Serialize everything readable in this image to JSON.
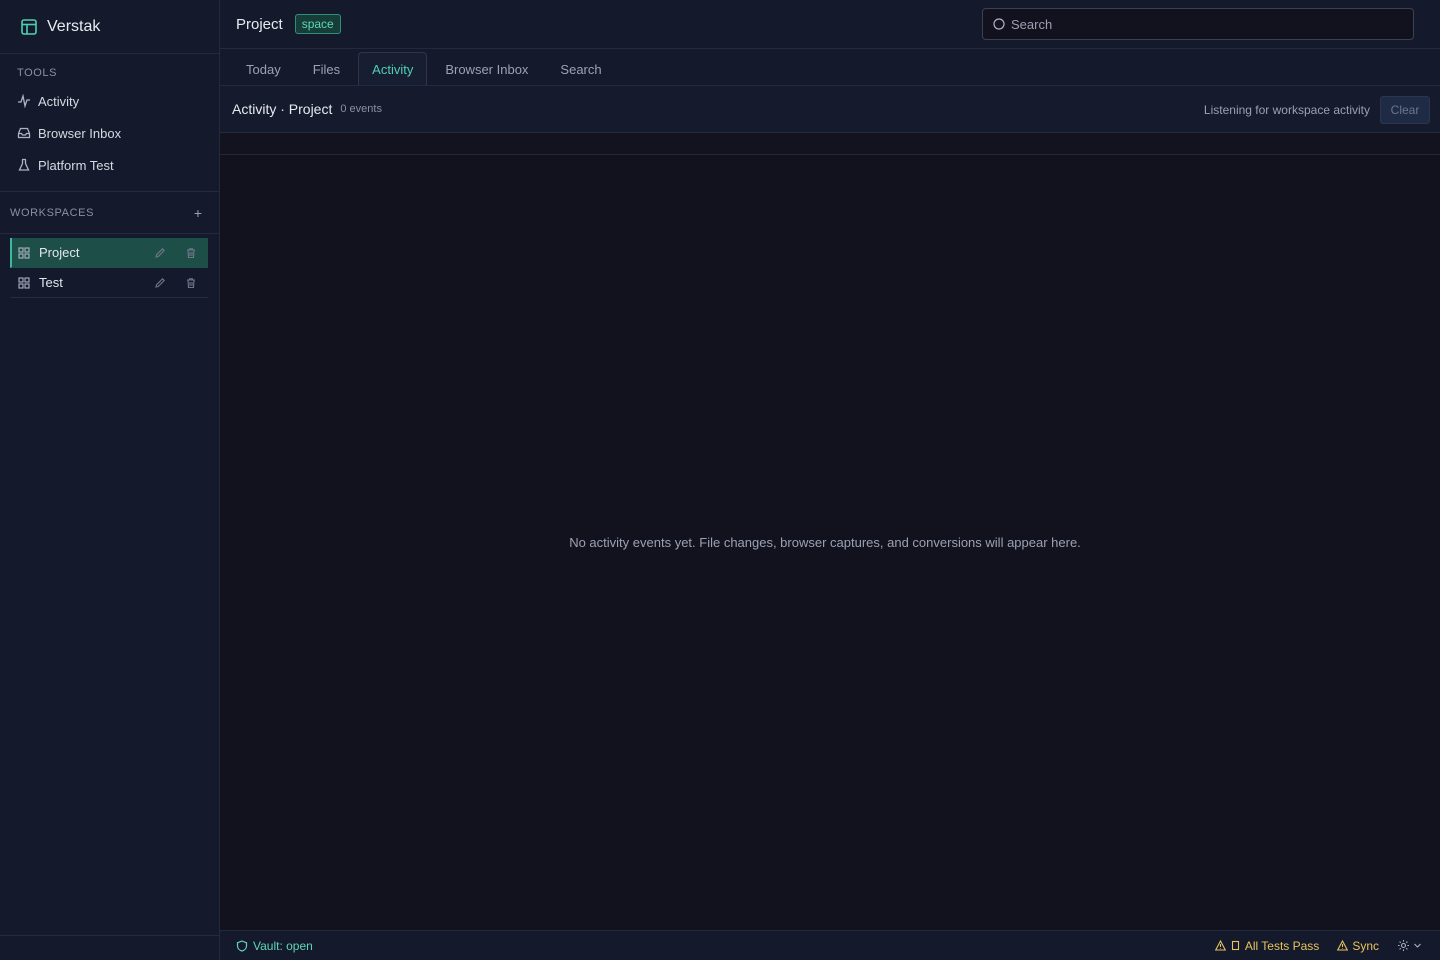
{
  "app": {
    "name": "Verstak"
  },
  "sidebar": {
    "tools_label": "TOOLS",
    "tools": [
      {
        "label": "Activity",
        "icon": "activity-icon"
      },
      {
        "label": "Browser Inbox",
        "icon": "inbox-icon"
      },
      {
        "label": "Platform Test",
        "icon": "flask-icon"
      }
    ],
    "workspaces_label": "WORKSPACES",
    "add_label": "+",
    "workspaces": [
      {
        "label": "Project",
        "active": true
      },
      {
        "label": "Test",
        "active": false
      }
    ]
  },
  "header": {
    "title": "Project",
    "badge": "space",
    "search_placeholder": "Search"
  },
  "tabs": [
    {
      "label": "Today",
      "active": false
    },
    {
      "label": "Files",
      "active": false
    },
    {
      "label": "Activity",
      "active": true
    },
    {
      "label": "Browser Inbox",
      "active": false
    },
    {
      "label": "Search",
      "active": false
    }
  ],
  "activity": {
    "title": "Activity · Project",
    "count": "0 events",
    "listening": "Listening for workspace activity",
    "clear_label": "Clear",
    "empty_message": "No activity events yet. File changes, browser captures, and conversions will appear here."
  },
  "status": {
    "vault": "Vault: open",
    "tests": "All Tests Pass",
    "sync": "Sync"
  },
  "colors": {
    "accent": "#4fcfb0",
    "warning": "#e8c25a",
    "background": "#12121f",
    "sidebar": "#141a2c"
  }
}
